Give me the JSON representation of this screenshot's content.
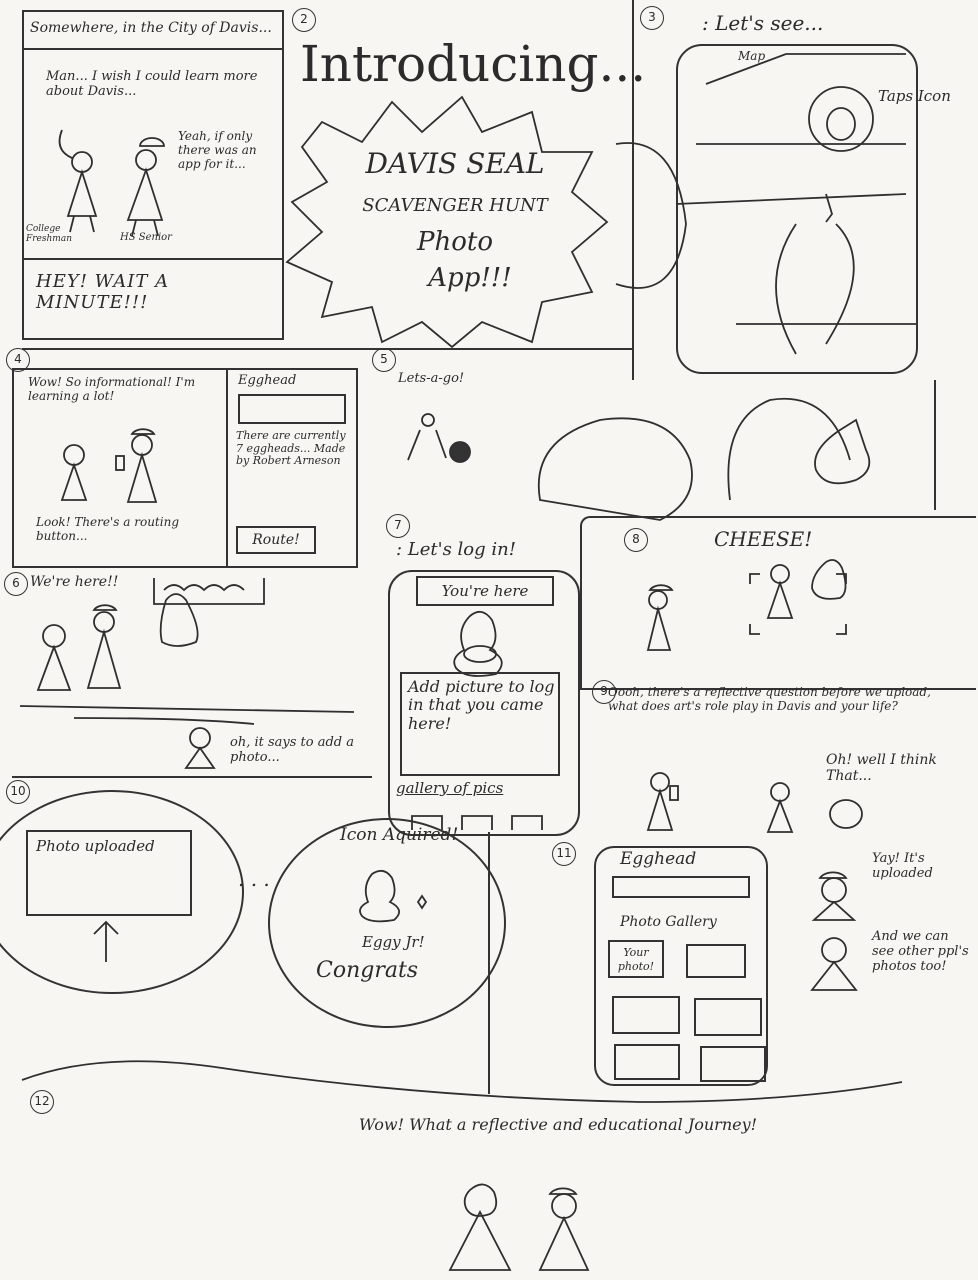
{
  "colors": {
    "paper": "#f7f6f2",
    "ink": "#2f2f2f"
  },
  "panel1": {
    "caption": "Somewhere, in the City of Davis...",
    "thought": "Man... I wish I could learn more about Davis...",
    "reply": "Yeah, if only there was an app for it...",
    "label_freshman": "College Freshman",
    "label_senior": "HS Senior",
    "shout": "HEY! WAIT A MINUTE!!!"
  },
  "panel2": {
    "number": "2",
    "heading": "Introducing...",
    "line1": "DAVIS SEAL",
    "line2": "SCAVENGER HUNT",
    "line3": "Photo",
    "line4": "App!!!"
  },
  "panel3": {
    "number": "3",
    "speech": ": Let's see...",
    "map_label": "Map",
    "taps_label": "Taps Icon"
  },
  "panel4": {
    "number": "4",
    "speech": "Wow! So informational! I'm learning a lot!",
    "look": "Look! There's a routing button...",
    "card_title": "Egghead",
    "card_text": "There are currently 7 eggheads... Made by Robert Arneson",
    "route_button": "Route!"
  },
  "panel5": {
    "number": "5",
    "speech": "Lets-a-go!"
  },
  "panel6": {
    "number": "6",
    "speech": "We're here!!",
    "says": "oh, it says to add a photo..."
  },
  "panel7": {
    "number": "7",
    "speech": ": Let's log in!",
    "header": "You're here",
    "body": "Add picture to log in that you came here!",
    "gallery": "gallery of pics"
  },
  "panel8": {
    "number": "8",
    "speech": "CHEESE!"
  },
  "panel9": {
    "number": "9",
    "speech": "Oooh, there's a reflective question before we upload, what does art's role play in Davis and your life?",
    "reply": "Oh! well I think That..."
  },
  "panel10": {
    "number": "10",
    "upload": "Photo uploaded",
    "icon_acquired": "Icon Aquired!",
    "name": "Eggy Jr!",
    "congrats": "Congrats"
  },
  "panel11": {
    "number": "11",
    "title": "Egghead",
    "gallery_label": "Photo Gallery",
    "your_photo": "Your photo!",
    "yay": "Yay! It's uploaded",
    "see": "And we can see other ppl's photos too!"
  },
  "panel12": {
    "number": "12",
    "speech": "Wow! What a reflective and educational Journey!"
  }
}
